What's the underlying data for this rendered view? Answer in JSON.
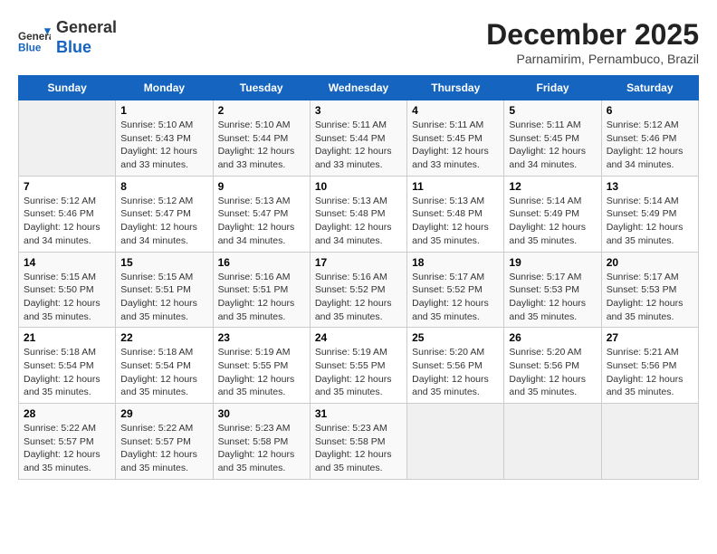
{
  "header": {
    "logo_general": "General",
    "logo_blue": "Blue",
    "month_title": "December 2025",
    "subtitle": "Parnamirim, Pernambuco, Brazil"
  },
  "days_of_week": [
    "Sunday",
    "Monday",
    "Tuesday",
    "Wednesday",
    "Thursday",
    "Friday",
    "Saturday"
  ],
  "weeks": [
    [
      {
        "day": "",
        "empty": true
      },
      {
        "day": "1",
        "sunrise": "5:10 AM",
        "sunset": "5:43 PM",
        "daylight": "12 hours and 33 minutes."
      },
      {
        "day": "2",
        "sunrise": "5:10 AM",
        "sunset": "5:44 PM",
        "daylight": "12 hours and 33 minutes."
      },
      {
        "day": "3",
        "sunrise": "5:11 AM",
        "sunset": "5:44 PM",
        "daylight": "12 hours and 33 minutes."
      },
      {
        "day": "4",
        "sunrise": "5:11 AM",
        "sunset": "5:45 PM",
        "daylight": "12 hours and 33 minutes."
      },
      {
        "day": "5",
        "sunrise": "5:11 AM",
        "sunset": "5:45 PM",
        "daylight": "12 hours and 34 minutes."
      },
      {
        "day": "6",
        "sunrise": "5:12 AM",
        "sunset": "5:46 PM",
        "daylight": "12 hours and 34 minutes."
      }
    ],
    [
      {
        "day": "7",
        "sunrise": "5:12 AM",
        "sunset": "5:46 PM",
        "daylight": "12 hours and 34 minutes."
      },
      {
        "day": "8",
        "sunrise": "5:12 AM",
        "sunset": "5:47 PM",
        "daylight": "12 hours and 34 minutes."
      },
      {
        "day": "9",
        "sunrise": "5:13 AM",
        "sunset": "5:47 PM",
        "daylight": "12 hours and 34 minutes."
      },
      {
        "day": "10",
        "sunrise": "5:13 AM",
        "sunset": "5:48 PM",
        "daylight": "12 hours and 34 minutes."
      },
      {
        "day": "11",
        "sunrise": "5:13 AM",
        "sunset": "5:48 PM",
        "daylight": "12 hours and 35 minutes."
      },
      {
        "day": "12",
        "sunrise": "5:14 AM",
        "sunset": "5:49 PM",
        "daylight": "12 hours and 35 minutes."
      },
      {
        "day": "13",
        "sunrise": "5:14 AM",
        "sunset": "5:49 PM",
        "daylight": "12 hours and 35 minutes."
      }
    ],
    [
      {
        "day": "14",
        "sunrise": "5:15 AM",
        "sunset": "5:50 PM",
        "daylight": "12 hours and 35 minutes."
      },
      {
        "day": "15",
        "sunrise": "5:15 AM",
        "sunset": "5:51 PM",
        "daylight": "12 hours and 35 minutes."
      },
      {
        "day": "16",
        "sunrise": "5:16 AM",
        "sunset": "5:51 PM",
        "daylight": "12 hours and 35 minutes."
      },
      {
        "day": "17",
        "sunrise": "5:16 AM",
        "sunset": "5:52 PM",
        "daylight": "12 hours and 35 minutes."
      },
      {
        "day": "18",
        "sunrise": "5:17 AM",
        "sunset": "5:52 PM",
        "daylight": "12 hours and 35 minutes."
      },
      {
        "day": "19",
        "sunrise": "5:17 AM",
        "sunset": "5:53 PM",
        "daylight": "12 hours and 35 minutes."
      },
      {
        "day": "20",
        "sunrise": "5:17 AM",
        "sunset": "5:53 PM",
        "daylight": "12 hours and 35 minutes."
      }
    ],
    [
      {
        "day": "21",
        "sunrise": "5:18 AM",
        "sunset": "5:54 PM",
        "daylight": "12 hours and 35 minutes."
      },
      {
        "day": "22",
        "sunrise": "5:18 AM",
        "sunset": "5:54 PM",
        "daylight": "12 hours and 35 minutes."
      },
      {
        "day": "23",
        "sunrise": "5:19 AM",
        "sunset": "5:55 PM",
        "daylight": "12 hours and 35 minutes."
      },
      {
        "day": "24",
        "sunrise": "5:19 AM",
        "sunset": "5:55 PM",
        "daylight": "12 hours and 35 minutes."
      },
      {
        "day": "25",
        "sunrise": "5:20 AM",
        "sunset": "5:56 PM",
        "daylight": "12 hours and 35 minutes."
      },
      {
        "day": "26",
        "sunrise": "5:20 AM",
        "sunset": "5:56 PM",
        "daylight": "12 hours and 35 minutes."
      },
      {
        "day": "27",
        "sunrise": "5:21 AM",
        "sunset": "5:56 PM",
        "daylight": "12 hours and 35 minutes."
      }
    ],
    [
      {
        "day": "28",
        "sunrise": "5:22 AM",
        "sunset": "5:57 PM",
        "daylight": "12 hours and 35 minutes."
      },
      {
        "day": "29",
        "sunrise": "5:22 AM",
        "sunset": "5:57 PM",
        "daylight": "12 hours and 35 minutes."
      },
      {
        "day": "30",
        "sunrise": "5:23 AM",
        "sunset": "5:58 PM",
        "daylight": "12 hours and 35 minutes."
      },
      {
        "day": "31",
        "sunrise": "5:23 AM",
        "sunset": "5:58 PM",
        "daylight": "12 hours and 35 minutes."
      },
      {
        "day": "",
        "empty": true
      },
      {
        "day": "",
        "empty": true
      },
      {
        "day": "",
        "empty": true
      }
    ]
  ]
}
